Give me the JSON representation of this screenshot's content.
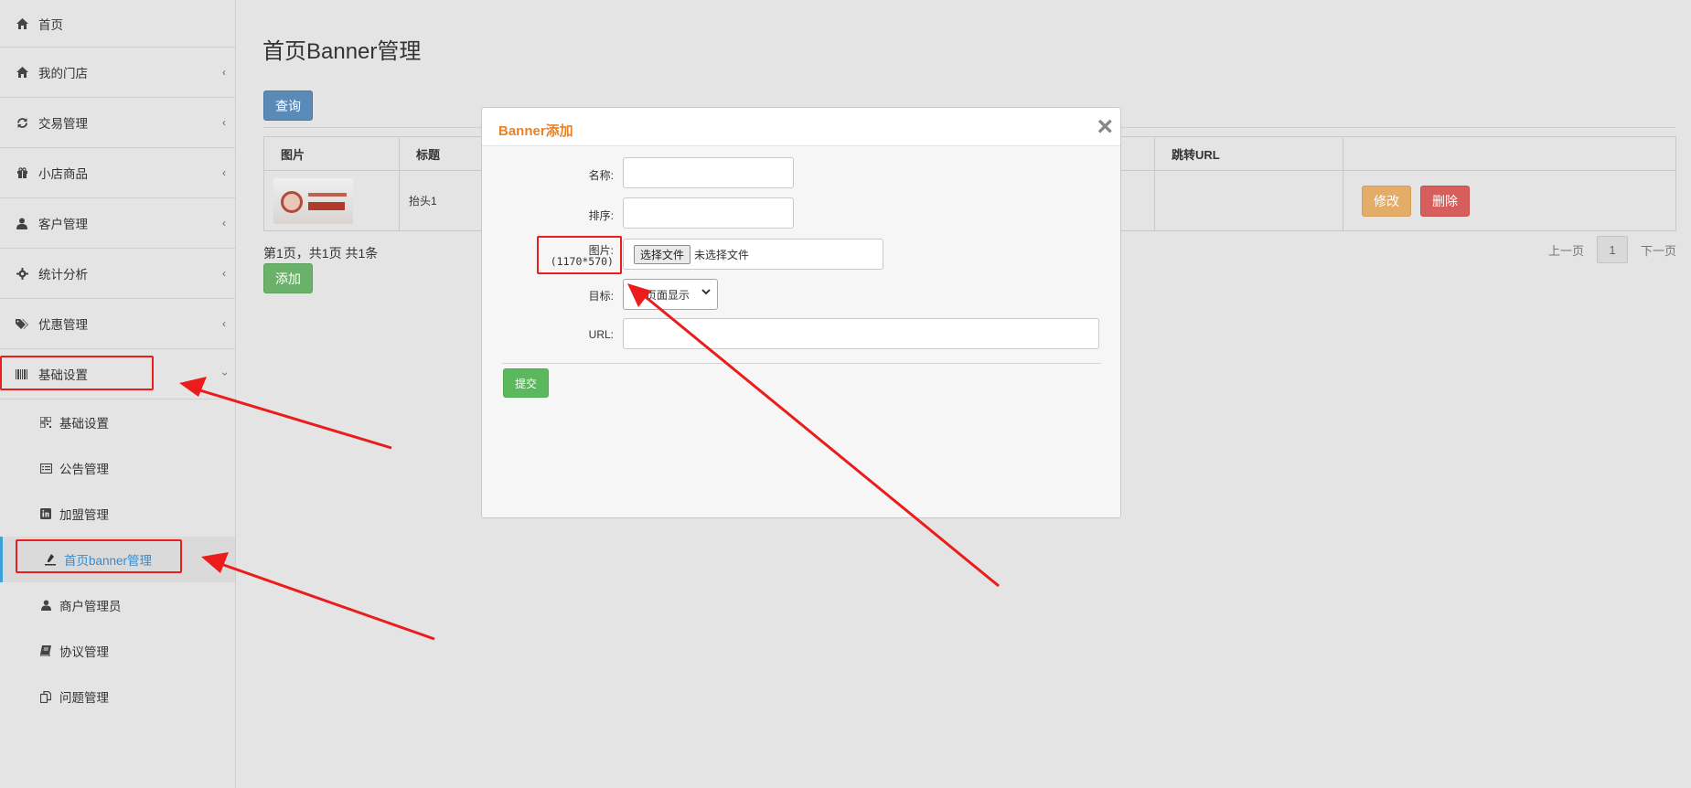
{
  "sidebar": {
    "items": [
      {
        "label": "首页",
        "icon": "home-icon"
      },
      {
        "label": "我的门店",
        "icon": "home-icon"
      },
      {
        "label": "交易管理",
        "icon": "refresh-icon"
      },
      {
        "label": "小店商品",
        "icon": "gift-icon"
      },
      {
        "label": "客户管理",
        "icon": "user-icon"
      },
      {
        "label": "统计分析",
        "icon": "gear-icon"
      },
      {
        "label": "优惠管理",
        "icon": "tags-icon"
      },
      {
        "label": "基础设置",
        "icon": "barcode-icon"
      }
    ],
    "sub_items": [
      {
        "label": "基础设置",
        "icon": "qrcode-icon"
      },
      {
        "label": "公告管理",
        "icon": "list-alt-icon"
      },
      {
        "label": "加盟管理",
        "icon": "linkedin-icon"
      },
      {
        "label": "首页banner管理",
        "icon": "tint-icon"
      },
      {
        "label": "商户管理员",
        "icon": "user-icon"
      },
      {
        "label": "协议管理",
        "icon": "book-icon"
      },
      {
        "label": "问题管理",
        "icon": "copy-icon"
      }
    ],
    "active_sub": "首页banner管理"
  },
  "main": {
    "title": "首页Banner管理",
    "query_label": "查询",
    "add_label": "添加",
    "table": {
      "headers": [
        "图片",
        "标题",
        "跳转URL",
        ""
      ],
      "rows": [
        {
          "title": "抬头1",
          "url": "",
          "edit_label": "修改",
          "delete_label": "删除"
        }
      ]
    },
    "page_info": "第1页，共1页 共1条",
    "pager": {
      "prev": "上一页",
      "current": "1",
      "next": "下一页"
    }
  },
  "modal": {
    "title": "Banner添加",
    "close": "×",
    "fields": {
      "name_label": "名称:",
      "sort_label": "排序:",
      "image_label": "图片:",
      "image_size": "(1170*570)",
      "file_button": "选择文件",
      "file_status": "未选择文件",
      "target_label": "目标:",
      "target_value": "本页面显示",
      "url_label": "URL:"
    },
    "submit_label": "提交"
  },
  "colors": {
    "accent_orange": "#e8832a",
    "annotation_red": "#ea1c1c",
    "active_blue": "#3a8ac8",
    "query_blue": "#5a8bb8",
    "add_green": "#6ab26a",
    "edit_orange": "#e3ad68",
    "delete_red": "#d65e5c"
  }
}
